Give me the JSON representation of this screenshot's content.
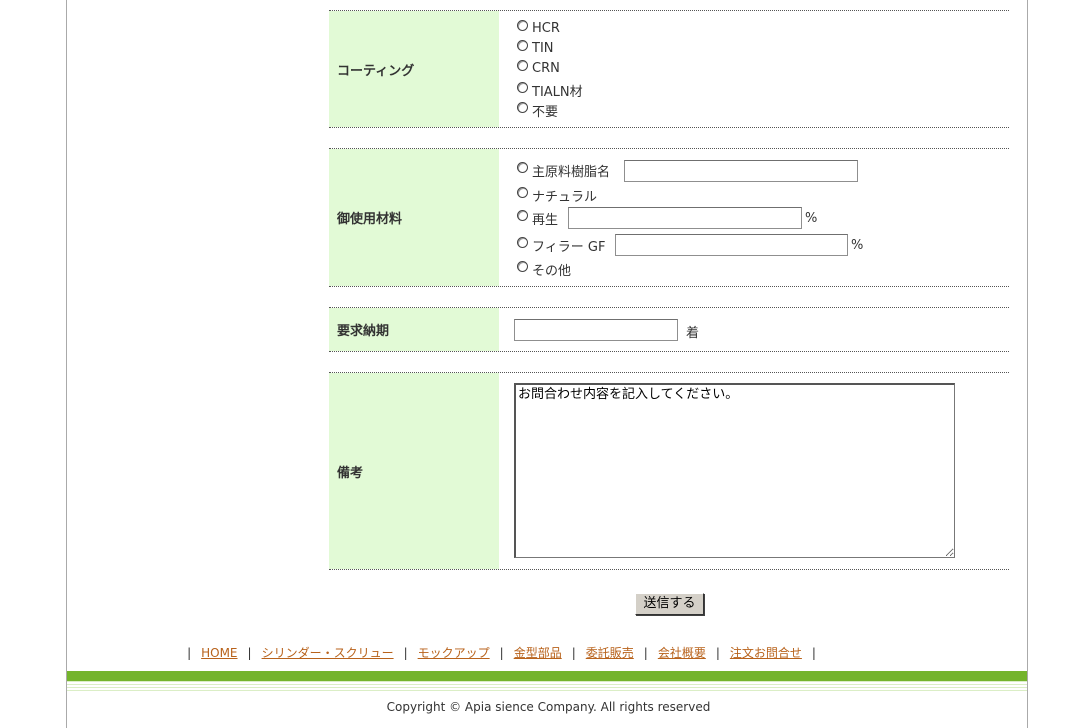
{
  "coating": {
    "label": "コーティング",
    "options": [
      "HCR",
      "TIN",
      "CRN",
      "TIALN材",
      "不要"
    ]
  },
  "material": {
    "label": "御使用材料",
    "options": {
      "resin": "主原料樹脂名",
      "natural": "ナチュラル",
      "recycled": "再生",
      "filler": "フィラー GF",
      "other": "その他"
    },
    "percent_unit": "%"
  },
  "deadline": {
    "label": "要求納期",
    "suffix": "着"
  },
  "remarks": {
    "label": "備考",
    "textarea_value": "お問合わせ内容を記入してください。"
  },
  "submit_label": "送信する",
  "footer_nav": {
    "separator": "|",
    "links": [
      "HOME",
      "シリンダー・スクリュー",
      "モックアップ",
      "金型部品",
      "委託販売",
      "会社概要",
      "注文お問合せ"
    ]
  },
  "copyright": "Copyright © Apia sience Company. All rights reserved",
  "colors": {
    "label_bg": "#e2fad6",
    "link": "#b8621b",
    "green_bar": "#74b42c"
  }
}
